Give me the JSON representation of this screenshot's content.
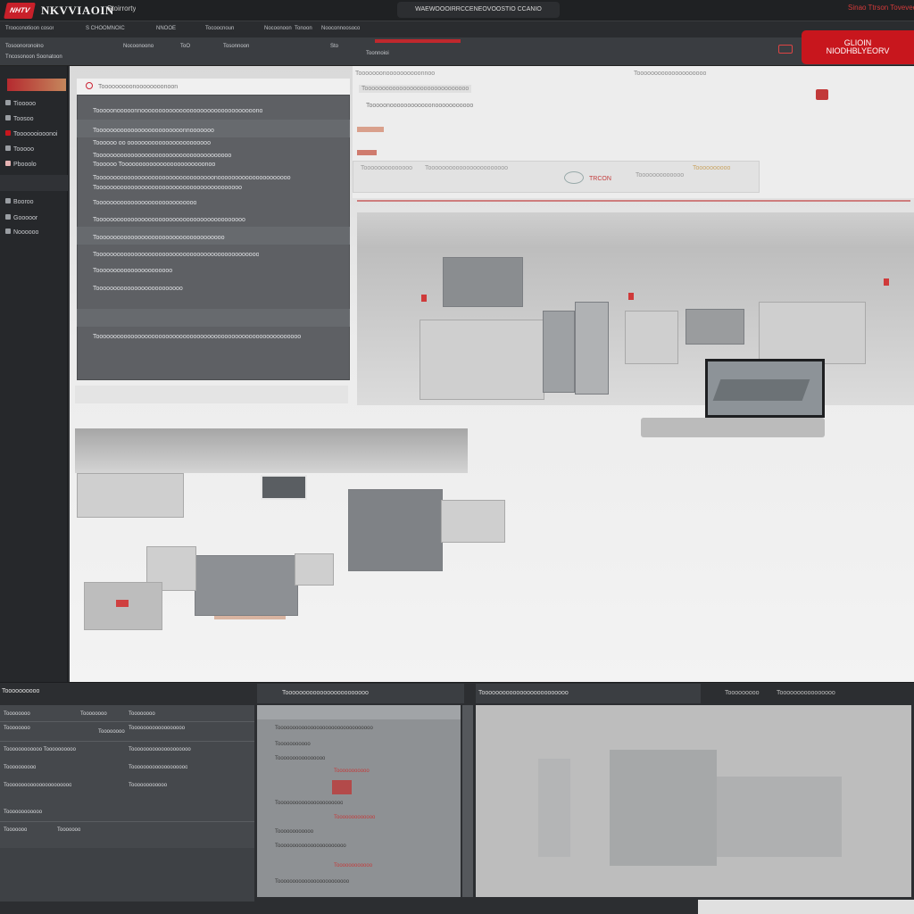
{
  "titlebar": {
    "logo_text": "NHTV",
    "brand": "NKVVIAOIN",
    "brand_sub": "Stoirrorty",
    "center_title": "WAEWOOOIRRCCENEOVOOSTIO CCANIO",
    "right_text": "Sinao Ttrson Tovevee"
  },
  "menubar": {
    "items": [
      "Trooconotioon cosor",
      "S CHOOMNOIC",
      "NNOOE",
      "Tocoocnoun",
      "Nocoonoon",
      "Tonoon",
      "Nooconnoosoco"
    ]
  },
  "toolbar": {
    "items": [
      "Tosoonoronoino",
      "Tncosonoon Soonatoon",
      "Nocoonoono",
      "Tosonnoon",
      "ToO",
      "Sto",
      "Toonnoioi"
    ],
    "cta_line1": "GLIOIN",
    "cta_line2": "NIODHBLYEORV"
  },
  "sidebar": {
    "items": [
      "Tiooooo",
      "Toosoo",
      "Tooooooiooonoi",
      "Tooooo",
      "Pbooolo",
      "Booroo",
      "Gooooor",
      "Noooooo"
    ]
  },
  "left_panel": {
    "header": "Tooooooooonoooooooonoon",
    "rows": [
      "Tooooonooooonnooooooooooooooooooooooooooooooooono",
      "Tooooooooooooooooooooooooonnooooooo",
      "Toooooo oo oooooooooooooooooooooooo",
      "Tooooooooooooooooooooooooooooooooooooooo",
      "Toooooo Toooooooooooooooooooooooonoo",
      "Toooooooooooooooooooooooooooooooooonooooooooooooooooooooo",
      "Toooooooooooooooooooooooooooooooooooooooooo",
      "Tooooooooooooooooooooooooooooo",
      "Tooooooooooooooooooooooooooooooooooooooooooo",
      "Tooooooooooooooooooooooooooooooooooooo",
      "Tooooooooooooooooooooooooooooooooooooooooooooooo",
      "Toooooooooooooooooooooo",
      "Tooooooooooooooooooooooooo",
      "Tooooooooooooooooooooooooooooooooooooooooooooooooooooooooooo"
    ]
  },
  "right_top": {
    "tabs": [
      "Tooooooonoooooooooonnoo",
      "Toooooooooooooooooooo",
      "Toooooooooooooooooooooooooooooo",
      "Toooooooooo Tooooo"
    ],
    "breadcrumb": "Tooooonoooooooooooonooooooooooo",
    "strip_items": [
      "Toooooooooooooo",
      "Tooooooooooooooooooooooo",
      "TRCON",
      "Tooooooooooooo",
      "Toooooooooo"
    ]
  },
  "bottom": {
    "panel1_title": "Toooooooooo",
    "panel1_rows": [
      [
        "Toooooooo",
        "Toooooooo",
        "Toooooooo"
      ],
      [
        "Toooooooo",
        "Toooooooo",
        "Toooooooooooooooooo"
      ],
      [
        "Toooooooooooo Toooooooooo",
        "Toooooooooooooooooooo",
        ""
      ],
      [
        "Toooooooooo",
        "Tooooooooooooooooooo",
        ""
      ],
      [
        "Toooooooooooooooooooooo",
        "Toooooooooooo",
        ""
      ],
      [
        "Toooooooooooo",
        "",
        ""
      ],
      [
        "Tooooooo",
        "Tooooooo",
        ""
      ]
    ],
    "panel2_title": "Toooooooooooooooooooooooo",
    "panel2_rows": [
      "Toooooooooooooooooooooooooooooooo",
      "Tooooooooooo",
      "Toooooooooooooooo",
      "Tooooooooooo",
      "Toooooooooooooooooooooo",
      "Tooooooooooooo",
      "Toooooooooooo",
      "Tooooooooooooooooooooooo",
      "Toooooooooooo",
      "Toooooooooooooooooooooooo"
    ],
    "panel3_title": "Tooooooooooooooooooooooooo",
    "panel3_tabs": [
      "Tooooooooo",
      "Toooooooooooooooo"
    ]
  },
  "colors": {
    "accent": "#c8161d",
    "chrome_dark": "#1f2123",
    "panel_gray": "#5e6064"
  }
}
